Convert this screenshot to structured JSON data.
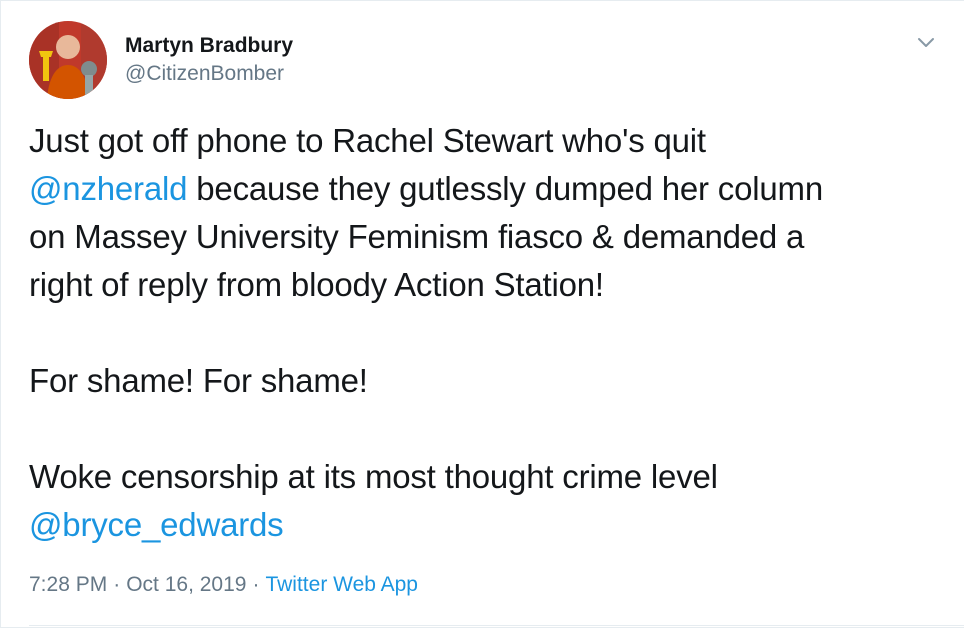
{
  "author": {
    "display_name": "Martyn Bradbury",
    "handle": "@CitizenBomber",
    "avatar_icon": "profile-photo"
  },
  "menu_icon": "chevron-down-icon",
  "tweet": {
    "line1": "Just got off phone to Rachel Stewart who's quit",
    "mention1": "@nzherald",
    "line2_rest": " because they gutlessly dumped her column",
    "line3": "on Massey University Feminism fiasco & demanded a",
    "line4": "right of reply from bloody Action Station!",
    "line5": "For shame! For shame!",
    "line6": "Woke censorship at its most thought crime level",
    "mention2": "@bryce_edwards"
  },
  "meta": {
    "time": "7:28 PM",
    "separator": "·",
    "date": "Oct 16, 2019",
    "source": "Twitter Web App"
  },
  "colors": {
    "text": "#14171a",
    "secondary": "#657786",
    "link": "#1b95e0",
    "border": "#e6ecf0"
  }
}
